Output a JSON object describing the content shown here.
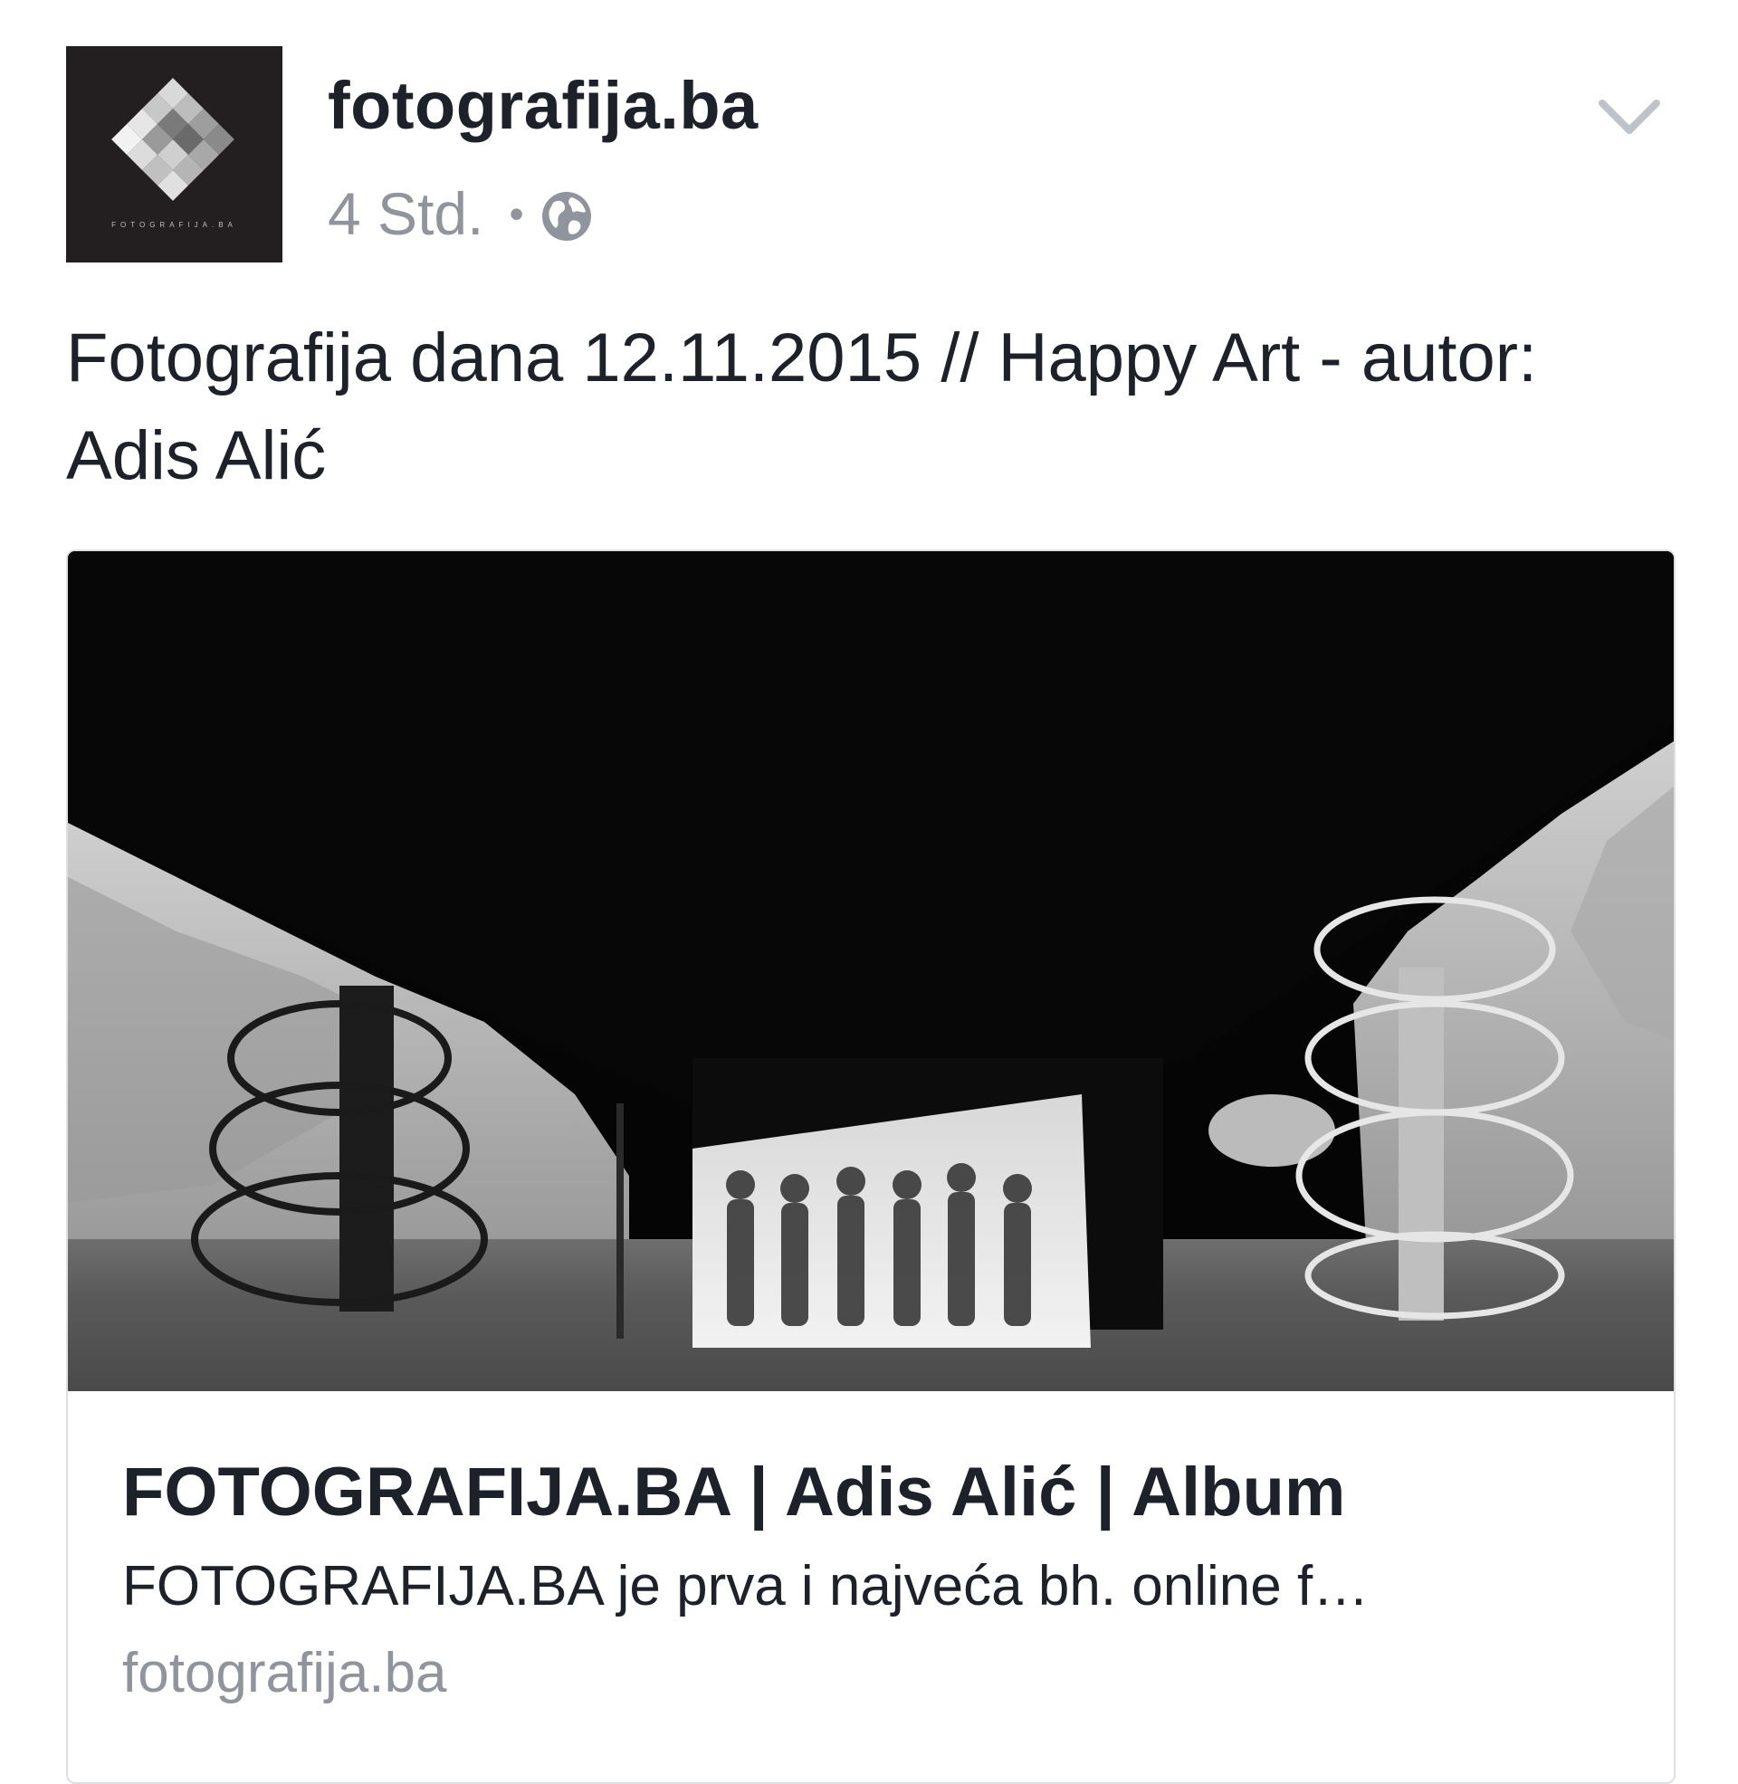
{
  "post": {
    "page_name": "fotografija.ba",
    "avatar": {
      "logo_text": "FOTOGRAFIJA.BA",
      "icon": "diamond-logo-icon"
    },
    "timestamp": "4 Std.",
    "separator": "•",
    "privacy_icon": "globe-icon",
    "menu_icon": "chevron-down-icon",
    "caption": "Fotografija dana 12.11.2015 // Happy Art - autor: Adis Alić"
  },
  "link_preview": {
    "image_icon": "photo-underpass-image",
    "title": "FOTOGRAFIJA.BA | Adis Alić | Album",
    "description": "FOTOGRAFIJA.BA je prva i najveća bh. online f…",
    "domain": "fotografija.ba"
  },
  "colors": {
    "text_primary": "#1d2129",
    "text_secondary": "#90949c",
    "card_border": "#dddfe2",
    "avatar_bg": "#231f20"
  }
}
